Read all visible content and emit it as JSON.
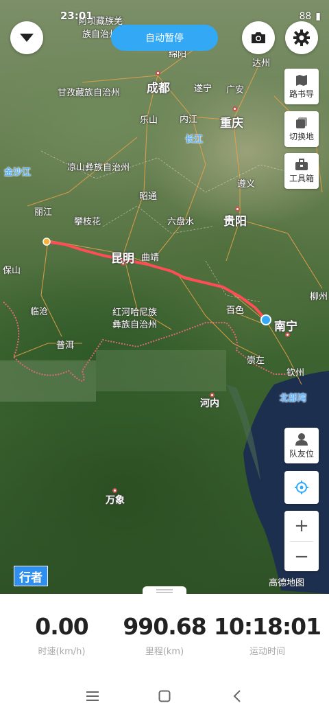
{
  "status_bar": {
    "time": "23:01",
    "signal_text": "88"
  },
  "top": {
    "pause_label": "自动暂停"
  },
  "map": {
    "places": {
      "chengdu": "成都",
      "chongqing": "重庆",
      "guiyang": "贵阳",
      "kunming": "昆明",
      "nanning": "南宁",
      "hanoi": "河内",
      "vientiane": "万象",
      "leshan": "乐山",
      "neijiang": "内江",
      "suining": "遂宁",
      "guangan": "广安",
      "dazhou": "达州",
      "mianyang": "绵阳",
      "zunyi": "遵义",
      "zhaotong": "昭通",
      "liupanshui": "六盘水",
      "panzhihua": "攀枝花",
      "lijiang": "丽江",
      "baoshan": "保山",
      "lincang": "临沧",
      "puer": "普洱",
      "qujing": "曲靖",
      "baise": "百色",
      "chongzuo": "崇左",
      "qinzhou": "钦州",
      "liuzhou": "柳州",
      "ganzi": "甘孜藏族自治州",
      "liangshan": "凉山彝族自治州",
      "honghe_1": "红河哈尼族",
      "honghe_2": "彝族自治州",
      "aba_1": "阿坝藏族羌",
      "aba_2": "族自治州",
      "yangtze": "长江",
      "jinsha": "金沙江",
      "beibu": "北部湾"
    },
    "brand_label": "行者",
    "amap_label": "高德地图"
  },
  "side_tools": {
    "road_book": "路书导",
    "switch_map": "切换地",
    "toolbox": "工具箱",
    "teammate": "队友位"
  },
  "zoom": {
    "in": "+",
    "out": "−"
  },
  "stats": {
    "speed": {
      "value": "0.00",
      "label": "时速(km/h)"
    },
    "distance": {
      "value": "990.68",
      "label": "里程(km)"
    },
    "duration": {
      "value": "10:18:01",
      "label": "运动时间"
    }
  },
  "colors": {
    "route": "#ff4d57",
    "accent": "#33a9f5",
    "border": "#e06a7a"
  }
}
